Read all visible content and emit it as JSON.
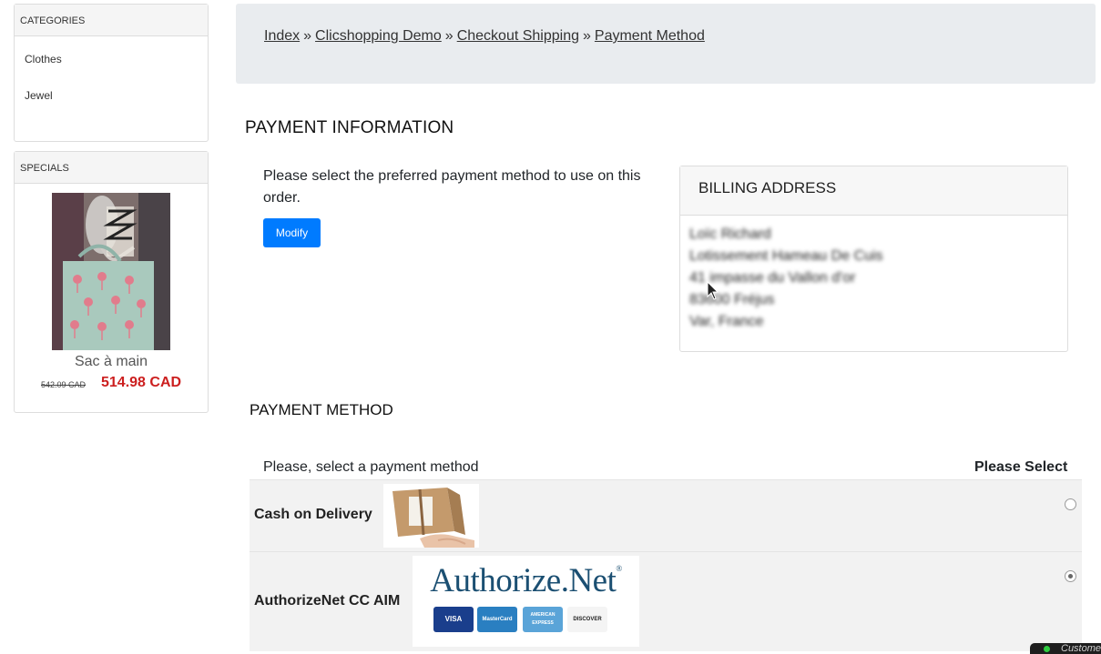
{
  "sidebar": {
    "categories": {
      "title": "CATEGORIES",
      "items": [
        {
          "label": "Clothes"
        },
        {
          "label": "Jewel"
        }
      ]
    },
    "specials": {
      "title": "SPECIALS",
      "product": {
        "name": "Sac à main",
        "old_price": "542.09 CAD",
        "new_price": "514.98 CAD"
      }
    }
  },
  "breadcrumb": {
    "items": [
      "Index",
      "Clicshopping Demo",
      "Checkout Shipping",
      "Payment Method"
    ],
    "separator": "»"
  },
  "payment_information": {
    "heading": "PAYMENT INFORMATION",
    "instruction": "Please select the preferred payment method to use on this order.",
    "modify_label": "Modify",
    "billing": {
      "heading": "BILLING ADDRESS",
      "lines": [
        "Loïc Richard",
        "Lotissement Hameau De Cuis",
        "41 impasse du Vallon d'or",
        "83600 Fréjus",
        "Var, France"
      ]
    }
  },
  "payment_method": {
    "heading": "PAYMENT METHOD",
    "instruction": "Please, select a payment method",
    "select_label": "Please Select",
    "methods": [
      {
        "label": "Cash on Delivery",
        "selected": false
      },
      {
        "label": "AuthorizeNet CC AIM",
        "selected": true,
        "logo_text": "Authorize.Net",
        "cards": [
          "VISA",
          "MasterCard",
          "AMERICAN EXPRESS",
          "DISCOVER"
        ]
      }
    ]
  },
  "chat": {
    "label": "Custome"
  },
  "colors": {
    "accent": "#007bff",
    "sale_price": "#cc1f1f",
    "breadcrumb_bg": "#e9ecef",
    "row_bg": "#f2f2f2"
  }
}
